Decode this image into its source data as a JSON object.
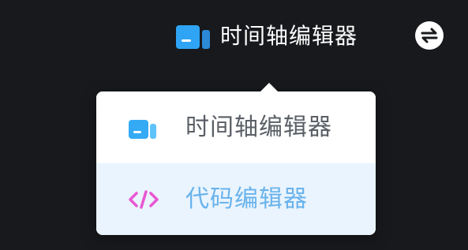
{
  "header": {
    "current_mode_label": "时间轴编辑器",
    "current_mode_icon": "timeline-editor-icon",
    "swap_icon": "swap-icon"
  },
  "dropdown": {
    "items": [
      {
        "label": "时间轴编辑器",
        "icon": "timeline-editor-icon",
        "state": "default"
      },
      {
        "label": "代码编辑器",
        "icon": "code-editor-icon",
        "state": "hovered"
      }
    ]
  },
  "colors": {
    "background": "#17191c",
    "accent_blue": "#2fa4f5",
    "hover_bg": "#eaf4fe",
    "hover_text": "#69b3ec",
    "code_icon": "#e956d2"
  }
}
